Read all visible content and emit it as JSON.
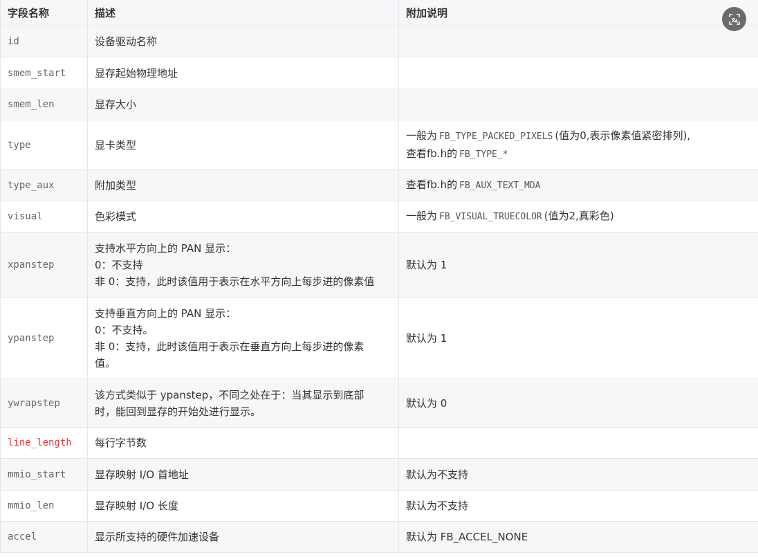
{
  "headers": [
    "字段名称",
    "描述",
    "附加说明"
  ],
  "rows": [
    {
      "field": "id",
      "desc": [
        "设备驱动名称"
      ],
      "note": []
    },
    {
      "field": "smem_start",
      "desc": [
        "显存起始物理地址"
      ],
      "note": []
    },
    {
      "field": "smem_len",
      "desc": [
        "显存大小"
      ],
      "note": []
    },
    {
      "field": "type",
      "desc": [
        "显卡类型"
      ],
      "note": [
        {
          "pre": "一般为",
          "code": "FB_TYPE_PACKED_PIXELS",
          "post": "(值为0,表示像素值紧密排列),"
        },
        {
          "pre": "查看fb.h的",
          "code": "FB_TYPE_*",
          "post": ""
        }
      ]
    },
    {
      "field": "type_aux",
      "desc": [
        "附加类型"
      ],
      "note": [
        {
          "pre": "查看fb.h的",
          "code": "FB_AUX_TEXT_MDA",
          "post": ""
        }
      ]
    },
    {
      "field": "visual",
      "desc": [
        "色彩模式"
      ],
      "note": [
        {
          "pre": "一般为",
          "code": "FB_VISUAL_TRUECOLOR",
          "post": "(值为2,真彩色)"
        }
      ]
    },
    {
      "field": "xpanstep",
      "desc": [
        "支持水平方向上的 PAN 显示：",
        "0：不支持",
        "非 0：支持，此时该值用于表示在水平方向上每步进的像素值"
      ],
      "note": [
        {
          "pre": "默认为 1",
          "code": "",
          "post": ""
        }
      ]
    },
    {
      "field": "ypanstep",
      "desc": [
        "支持垂直方向上的 PAN 显示：",
        "0：不支持。",
        "非 0：支持，此时该值用于表示在垂直方向上每步进的像素",
        "值。"
      ],
      "note": [
        {
          "pre": "默认为 1",
          "code": "",
          "post": ""
        }
      ]
    },
    {
      "field": "ywrapstep",
      "desc": [
        "该方式类似于 ypanstep，不同之处在于：当其显示到底部",
        "时，能回到显存的开始处进行显示。"
      ],
      "note": [
        {
          "pre": "默认为 0",
          "code": "",
          "post": ""
        }
      ]
    },
    {
      "field": "line_length",
      "highlight": true,
      "desc": [
        "每行字节数"
      ],
      "note": []
    },
    {
      "field": "mmio_start",
      "desc": [
        "显存映射 I/O 首地址"
      ],
      "note": [
        {
          "pre": "默认为不支持",
          "code": "",
          "post": ""
        }
      ]
    },
    {
      "field": "mmio_len",
      "desc": [
        "显存映射 I/O 长度"
      ],
      "note": [
        {
          "pre": "默认为不支持",
          "code": "",
          "post": ""
        }
      ]
    },
    {
      "field": "accel",
      "desc": [
        "显示所支持的硬件加速设备"
      ],
      "note": [
        {
          "pre": "默认为 FB_ACCEL_NONE",
          "code": "",
          "post": ""
        }
      ]
    }
  ],
  "close_icon": "translate-close-icon"
}
